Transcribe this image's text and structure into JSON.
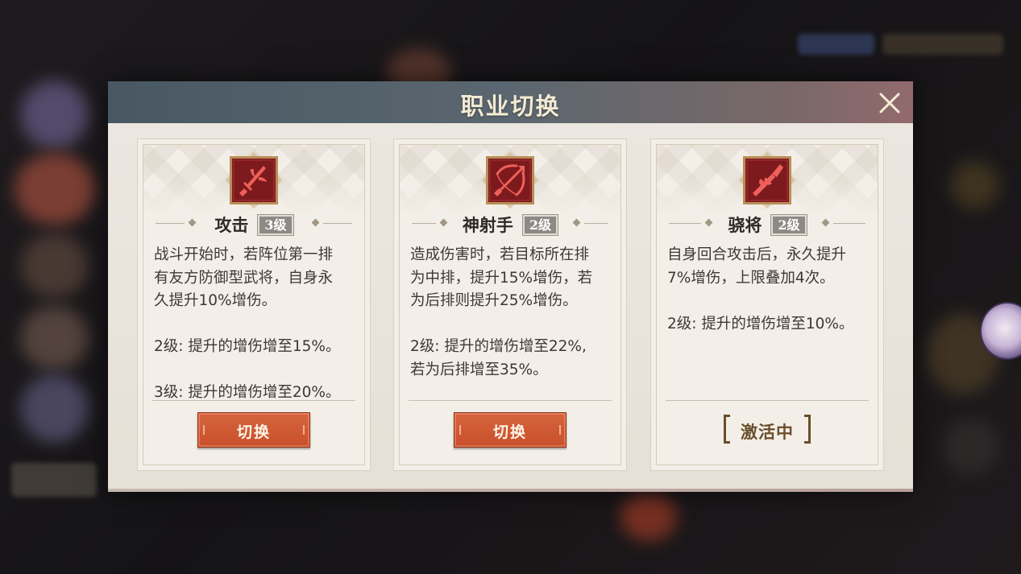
{
  "dialog": {
    "title": "职业切换"
  },
  "cards": [
    {
      "name": "攻击",
      "level": "3级",
      "icon": "sword-icon",
      "desc": [
        "战斗开始时，若阵位第一排",
        "有友方防御型武将，自身永",
        "久提升10%增伤。"
      ],
      "level2": "2级: 提升的增伤增至15%。",
      "level3": "3级: 提升的增伤增至20%。",
      "action": "切换"
    },
    {
      "name": "神射手",
      "level": "2级",
      "icon": "bow-icon",
      "desc": [
        "造成伤害时，若目标所在排",
        "为中排，提升15%增伤，若",
        "为后排则提升25%增伤。"
      ],
      "level2": [
        "2级: 提升的增伤增至22%,",
        "若为后排增至35%。"
      ],
      "action": "切换"
    },
    {
      "name": "骁将",
      "level": "2级",
      "icon": "spear-icon",
      "desc": [
        "自身回合攻击后，永久提升",
        "7%增伤，上限叠加4次。"
      ],
      "level2": "2级: 提升的增伤增至10%。",
      "status": "激活中"
    }
  ],
  "colors": {
    "header_gradient_start": "#485863",
    "header_gradient_end": "#926a6e",
    "icon_bg": "#7d1a1d",
    "icon_glyph": "#f0605a",
    "switch_button": "#d25a33",
    "active_status": "#6a4e2a"
  }
}
